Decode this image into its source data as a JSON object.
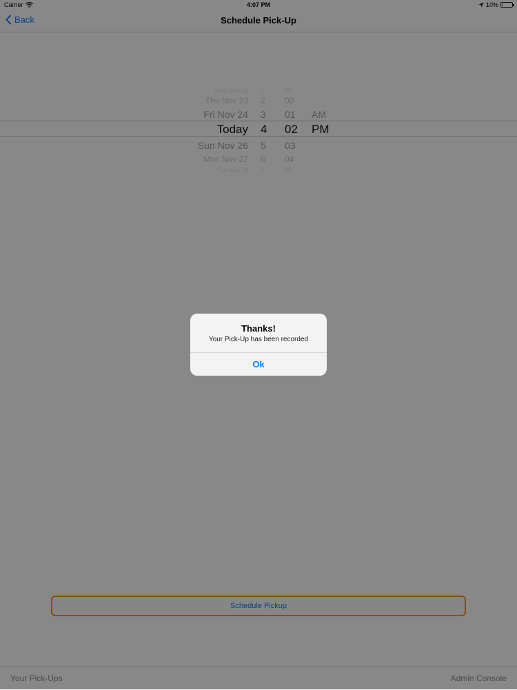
{
  "status_bar": {
    "carrier": "Carrier",
    "time": "4:07 PM",
    "battery": "10%",
    "battery_level": 0.1
  },
  "nav": {
    "back_label": "Back",
    "title": "Schedule Pick-Up"
  },
  "picker": {
    "dates": [
      "Wed Nov 22",
      "Thu Nov 23",
      "Fri Nov 24",
      "Today",
      "Sun Nov 26",
      "Mon Nov 27",
      "Tue Nov 28"
    ],
    "hours": [
      "1",
      "2",
      "3",
      "4",
      "5",
      "6",
      "7"
    ],
    "minutes": [
      "59",
      "00",
      "01",
      "02",
      "03",
      "04",
      "05"
    ],
    "ampm": [
      "AM",
      "PM"
    ]
  },
  "schedule_button": {
    "label": "Schedule Pickup"
  },
  "tab_bar": {
    "left": "Your Pick-Ups",
    "right": "Admin Console"
  },
  "alert": {
    "title": "Thanks!",
    "message": "Your Pick-Up has been recorded",
    "ok_label": "Ok"
  },
  "colors": {
    "accent": "#0a7aff",
    "button_border": "#ff8c00"
  }
}
